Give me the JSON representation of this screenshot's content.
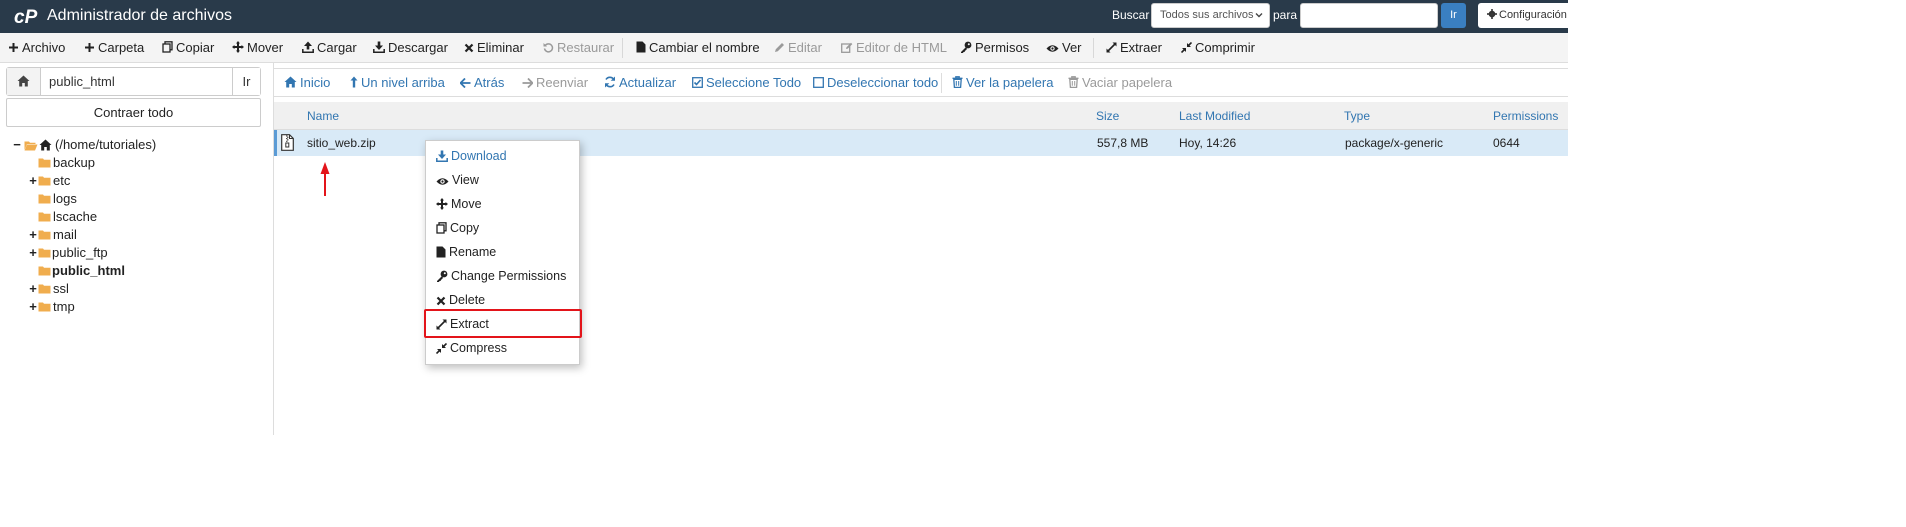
{
  "header": {
    "title": "Administrador de archivos",
    "search_label": "Buscar",
    "search_scope": "Todos sus archivos",
    "para_label": "para",
    "search_value": "",
    "go_label": "Ir",
    "settings_label": "Configuración",
    "logo_icon": "cpanel-logo"
  },
  "toolbar": {
    "items": [
      {
        "label": "Archivo",
        "icon": "plus-icon",
        "enabled": true
      },
      {
        "label": "Carpeta",
        "icon": "plus-icon",
        "enabled": true
      },
      {
        "label": "Copiar",
        "icon": "copy-icon",
        "enabled": true
      },
      {
        "label": "Mover",
        "icon": "move-icon",
        "enabled": true
      },
      {
        "label": "Cargar",
        "icon": "upload-icon",
        "enabled": true
      },
      {
        "label": "Descargar",
        "icon": "download-icon",
        "enabled": true
      },
      {
        "label": "Eliminar",
        "icon": "times-icon",
        "enabled": true
      },
      {
        "label": "Restaurar",
        "icon": "undo-icon",
        "enabled": false
      },
      {
        "label": "Cambiar el nombre",
        "icon": "file-icon",
        "enabled": true
      },
      {
        "label": "Editar",
        "icon": "pencil-icon",
        "enabled": false
      },
      {
        "label": "Editor de HTML",
        "icon": "edit-icon",
        "enabled": false
      },
      {
        "label": "Permisos",
        "icon": "key-icon",
        "enabled": true
      },
      {
        "label": "Ver",
        "icon": "eye-icon",
        "enabled": true
      },
      {
        "label": "Extraer",
        "icon": "expand-icon",
        "enabled": true
      },
      {
        "label": "Comprimir",
        "icon": "compress-icon",
        "enabled": true
      }
    ]
  },
  "sidebar": {
    "path_value": "public_html",
    "go_label": "Ir",
    "collapse_label": "Contraer todo",
    "tree": [
      {
        "label": "(/home/tutoriales)",
        "toggle": "−",
        "bold": false
      },
      {
        "label": "backup",
        "toggle": "",
        "bold": false
      },
      {
        "label": "etc",
        "toggle": "+",
        "bold": false
      },
      {
        "label": "logs",
        "toggle": "",
        "bold": false
      },
      {
        "label": "lscache",
        "toggle": "",
        "bold": false
      },
      {
        "label": "mail",
        "toggle": "+",
        "bold": false
      },
      {
        "label": "public_ftp",
        "toggle": "+",
        "bold": false
      },
      {
        "label": "public_html",
        "toggle": "",
        "bold": true
      },
      {
        "label": "ssl",
        "toggle": "+",
        "bold": false
      },
      {
        "label": "tmp",
        "toggle": "+",
        "bold": false
      }
    ]
  },
  "nav": {
    "items": [
      {
        "label": "Inicio",
        "icon": "home-icon",
        "enabled": true
      },
      {
        "label": "Un nivel arriba",
        "icon": "level-up-icon",
        "enabled": true
      },
      {
        "label": "Atrás",
        "icon": "arrow-left-icon",
        "enabled": true
      },
      {
        "label": "Reenviar",
        "icon": "arrow-right-icon",
        "enabled": false
      },
      {
        "label": "Actualizar",
        "icon": "refresh-icon",
        "enabled": true
      },
      {
        "label": "Seleccione Todo",
        "icon": "check-square-icon",
        "enabled": true
      },
      {
        "label": "Deseleccionar todo",
        "icon": "square-icon",
        "enabled": true
      },
      {
        "label": "Ver la papelera",
        "icon": "trash-icon",
        "enabled": true
      },
      {
        "label": "Vaciar papelera",
        "icon": "trash-icon",
        "enabled": false
      }
    ]
  },
  "table": {
    "columns": [
      "Name",
      "Size",
      "Last Modified",
      "Type",
      "Permissions"
    ],
    "rows": [
      {
        "name": "sitio_web.zip",
        "size": "557,8 MB",
        "modified": "Hoy, 14:26",
        "type": "package/x-generic",
        "perms": "0644",
        "icon": "zip-file-icon",
        "selected": true
      }
    ]
  },
  "context_menu": {
    "items": [
      {
        "label": "Download",
        "icon": "download-icon",
        "highlighted": false
      },
      {
        "label": "View",
        "icon": "eye-icon",
        "highlighted": false
      },
      {
        "label": "Move",
        "icon": "move-icon",
        "highlighted": false
      },
      {
        "label": "Copy",
        "icon": "copy-icon",
        "highlighted": false
      },
      {
        "label": "Rename",
        "icon": "file-icon",
        "highlighted": false
      },
      {
        "label": "Change Permissions",
        "icon": "key-icon",
        "highlighted": false
      },
      {
        "label": "Delete",
        "icon": "times-icon",
        "highlighted": false
      },
      {
        "label": "Extract",
        "icon": "expand-icon",
        "highlighted": true
      },
      {
        "label": "Compress",
        "icon": "compress-icon",
        "highlighted": false
      }
    ]
  },
  "colors": {
    "header_bg": "#293a4a",
    "link_blue": "#3276b1",
    "selected_row": "#d9eaf7",
    "annotation_red": "#e3141a",
    "folder": "#f0ad4e"
  }
}
